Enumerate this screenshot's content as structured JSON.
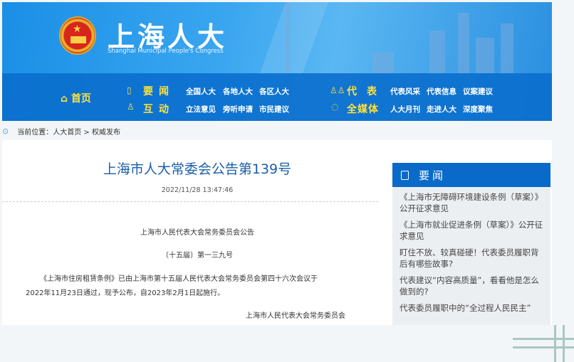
{
  "header": {
    "logo_cn": "上海人大",
    "logo_en": "Shanghai Municipal People's Congress"
  },
  "nav": {
    "home": "首页",
    "rows": [
      {
        "cat": "要闻",
        "links": [
          "全国人大",
          "各地人大",
          "各区人大"
        ]
      },
      {
        "cat": "互动",
        "links": [
          "立法意见",
          "旁听申请",
          "市民建议"
        ]
      },
      {
        "cat": "代表",
        "links": [
          "代表风采",
          "代表信息",
          "议案建议"
        ]
      },
      {
        "cat": "全媒体",
        "links": [
          "人大月刊",
          "走进人大",
          "深度聚焦"
        ]
      }
    ]
  },
  "breadcrumb": {
    "label": "当前位置：",
    "home": "人大首页",
    "sep": ">",
    "current": "权威发布"
  },
  "article": {
    "title": "上海市人大常委会公告第139号",
    "date": "2022/11/28 13:47:46",
    "heading": "上海市人民代表大会常务委员会公告",
    "number": "〔十五届〕第一三九号",
    "body_line1": "《上海市住房租赁条例》已由上海市第十五届人民代表大会常务委员会第四十六次会议于",
    "body_line2": "2022年11月23日通过，现予公布，自2023年2月1日起施行。",
    "signature": "上海市人民代表大会常务委员会"
  },
  "sidebar": {
    "title": "要闻",
    "items": [
      "《上海市无障碍环境建设条例（草案）》公开征求意见",
      "《上海市就业促进条例（草案）》公开征求意见",
      "盯住不放、较真碰硬！代表委员履职背后有哪些故事?",
      "代表建议“内容高质量”，看看他是怎么做到的?",
      "代表委员履职中的“全过程人民民主”"
    ]
  }
}
